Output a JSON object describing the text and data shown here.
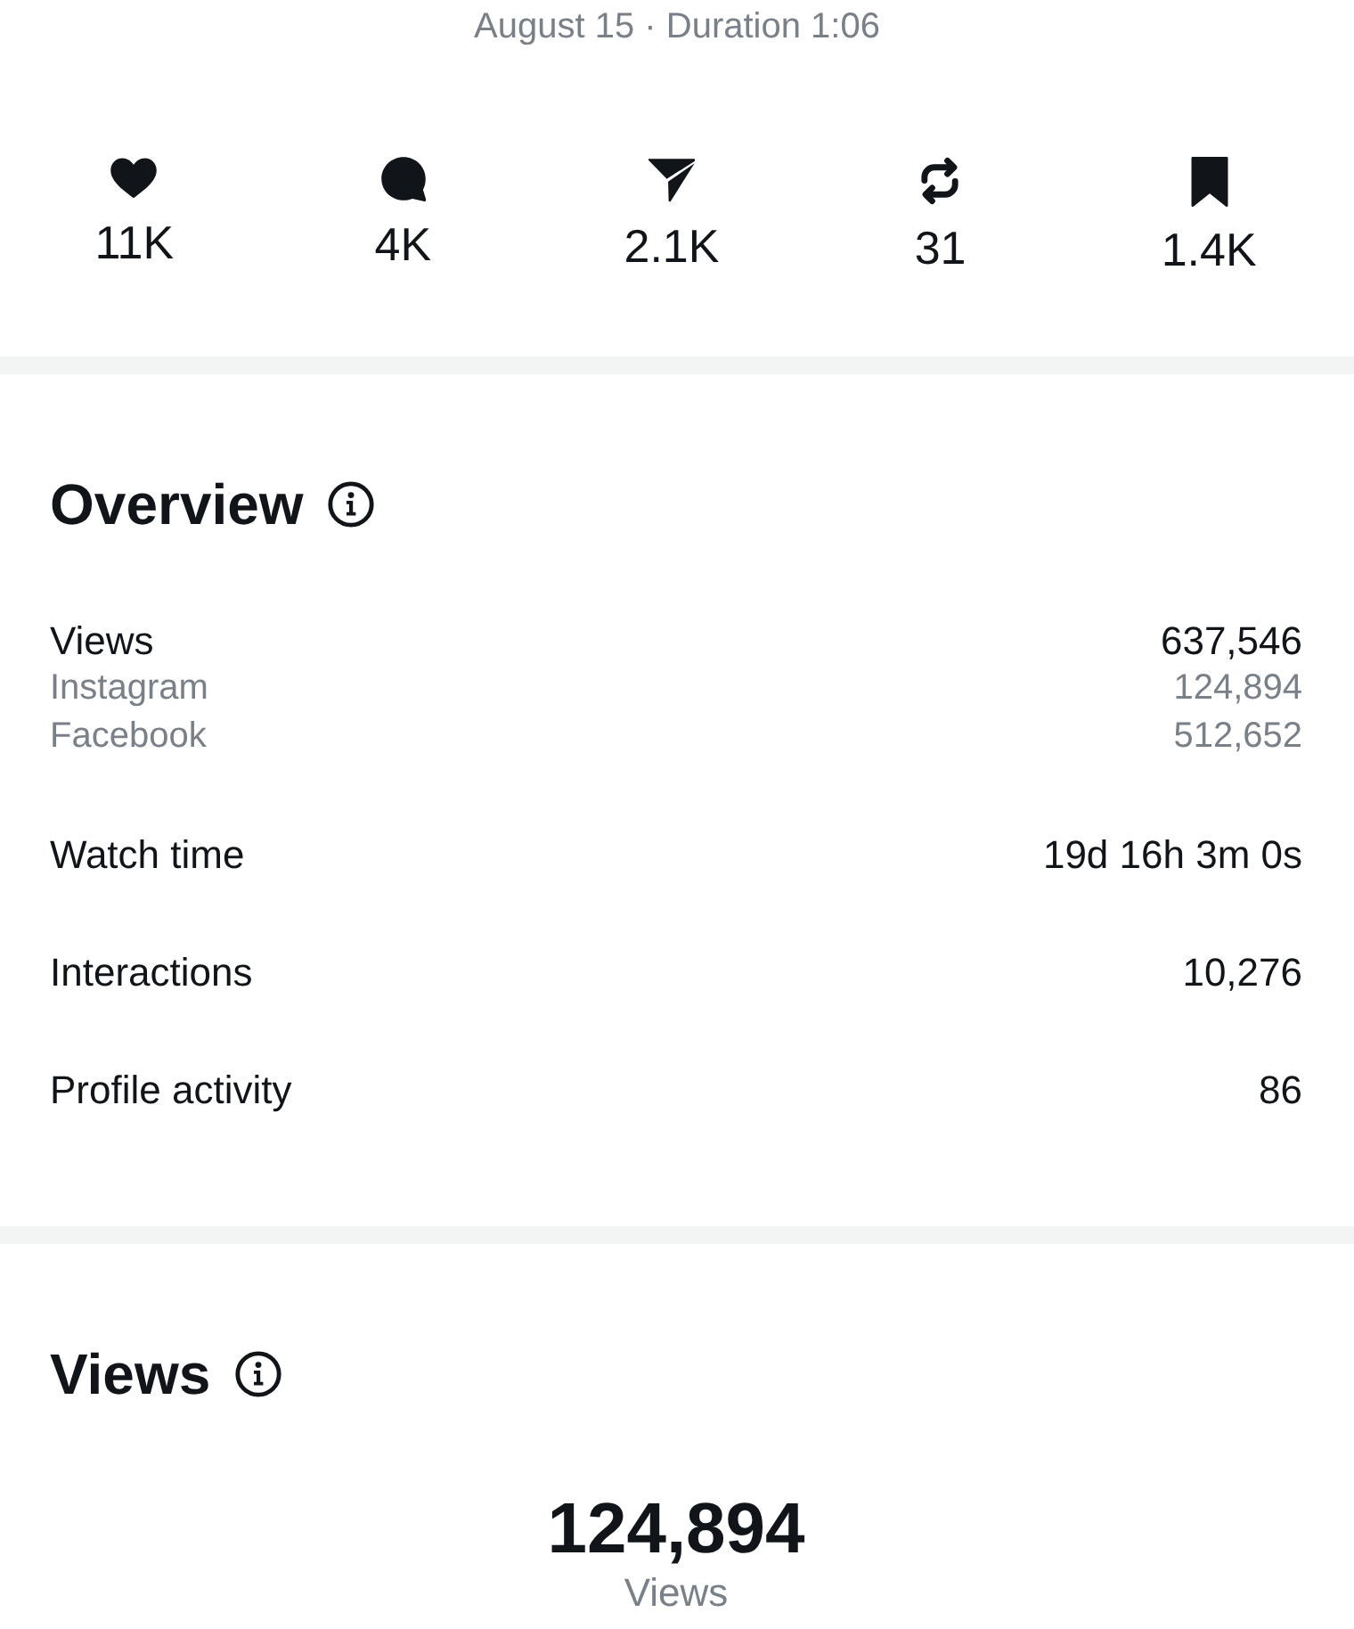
{
  "header": {
    "date_line": "August 15 · Duration 1:06"
  },
  "engagement": [
    {
      "kind": "likes",
      "count": "11K"
    },
    {
      "kind": "comments",
      "count": "4K"
    },
    {
      "kind": "shares",
      "count": "2.1K"
    },
    {
      "kind": "reposts",
      "count": "31"
    },
    {
      "kind": "saves",
      "count": "1.4K"
    }
  ],
  "overview": {
    "title": "Overview",
    "rows": [
      {
        "label": "Views",
        "value": "637,546",
        "breakdown": [
          {
            "label": "Instagram",
            "value": "124,894"
          },
          {
            "label": "Facebook",
            "value": "512,652"
          }
        ]
      },
      {
        "label": "Watch time",
        "value": "19d 16h 3m 0s"
      },
      {
        "label": "Interactions",
        "value": "10,276"
      },
      {
        "label": "Profile activity",
        "value": "86"
      }
    ]
  },
  "views": {
    "title": "Views",
    "total": "124,894",
    "total_label": "Views"
  }
}
